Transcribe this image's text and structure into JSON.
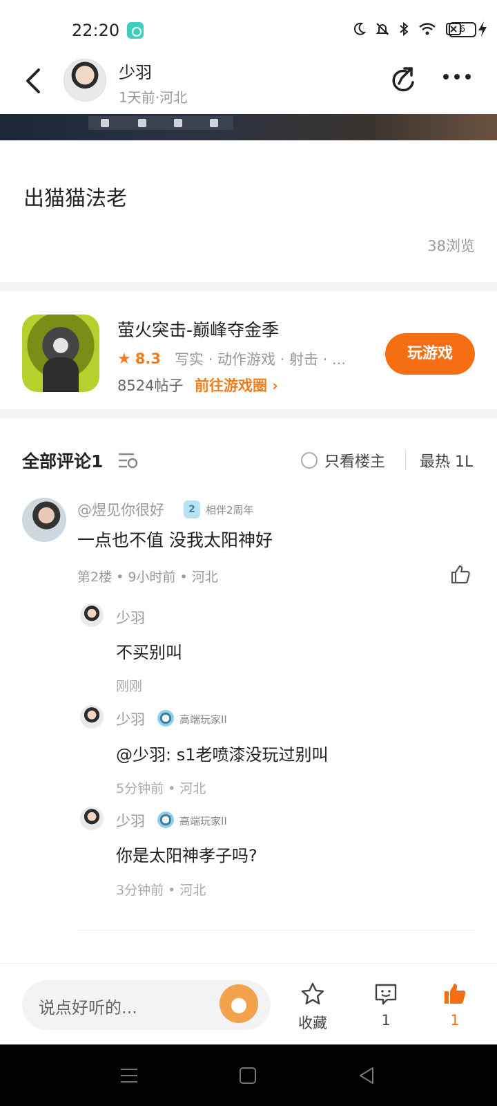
{
  "status_bar": {
    "time": "22:20",
    "battery": "6"
  },
  "header": {
    "author_name": "少羽",
    "author_meta": "1天前·河北"
  },
  "post": {
    "title": "出猫猫法老",
    "views": "38浏览"
  },
  "game": {
    "name": "萤火突击-巅峰夺金季",
    "score": "8.3",
    "tags": "写实 · 动作游戏 · 射击 · ...",
    "posts": "8524帖子",
    "link": "前往游戏圈 ›",
    "play_label": "玩游戏",
    "accent": "#f56e12"
  },
  "comments": {
    "title": "全部评论1",
    "only_host": "只看楼主",
    "sort": "最热 1L",
    "main": {
      "name": "@煜见你很好",
      "badge_level": "2",
      "badge_text": "相伴2周年",
      "text": "一点也不值  没我太阳神好",
      "meta": "第2楼 • 9小时前 • 河北"
    },
    "replies": [
      {
        "name": "少羽",
        "badge": "",
        "text": "不买别叫",
        "meta": "刚刚"
      },
      {
        "name": "少羽",
        "badge": "高端玩家II",
        "text": "@少羽:  s1老喷漆没玩过别叫",
        "meta": "5分钟前 • 河北"
      },
      {
        "name": "少羽",
        "badge": "高端玩家II",
        "text": "你是太阳神孝子吗?",
        "meta": "3分钟前 • 河北"
      }
    ]
  },
  "bottom": {
    "placeholder": "说点好听的...",
    "collect_label": "收藏",
    "comment_count": "1",
    "like_count": "1"
  }
}
